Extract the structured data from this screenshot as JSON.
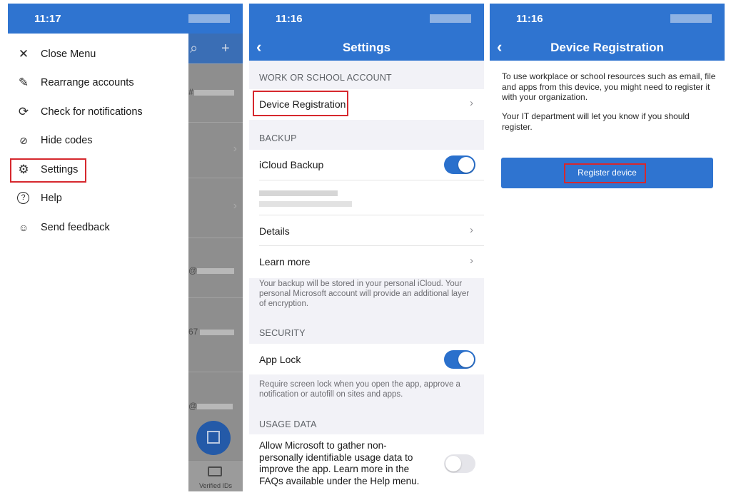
{
  "panel1": {
    "time": "11:17",
    "menu": [
      {
        "icon": "close-icon",
        "label": "Close Menu"
      },
      {
        "icon": "pencil-icon",
        "label": "Rearrange accounts"
      },
      {
        "icon": "refresh-icon",
        "label": "Check for notifications"
      },
      {
        "icon": "eye-slash-icon",
        "label": "Hide codes"
      },
      {
        "icon": "gear-icon",
        "label": "Settings"
      },
      {
        "icon": "help-icon",
        "label": "Help"
      },
      {
        "icon": "feedback-icon",
        "label": "Send feedback"
      }
    ],
    "background_list": {
      "partial_texts": [
        "#",
        "@",
        "67",
        "@"
      ]
    },
    "verified_ids_label": "Verified IDs"
  },
  "panel2": {
    "time": "11:16",
    "title": "Settings",
    "sections": {
      "work": {
        "header": "WORK OR SCHOOL ACCOUNT",
        "device_registration": "Device Registration"
      },
      "backup": {
        "header": "BACKUP",
        "icloud_backup": "iCloud Backup",
        "icloud_backup_on": true,
        "details": "Details",
        "learn_more": "Learn more",
        "footnote": "Your backup will be stored in your personal iCloud. Your personal Microsoft account will provide an additional layer of encryption."
      },
      "security": {
        "header": "SECURITY",
        "app_lock": "App Lock",
        "app_lock_on": true,
        "footnote": "Require screen lock when you open the app, approve a notification or autofill on sites and apps."
      },
      "usage": {
        "header": "USAGE DATA",
        "text": "Allow Microsoft to gather non-personally identifiable usage data to improve the app. Learn more in the FAQs available under the Help menu.",
        "toggle_on": false
      }
    }
  },
  "panel3": {
    "time": "11:16",
    "title": "Device Registration",
    "paragraph1": "To use workplace or school resources such as email, file and apps from this device, you might need to register it with your organization.",
    "paragraph2": "Your IT department will let you know if you should register.",
    "register_button": "Register device"
  },
  "colors": {
    "brand_blue": "#2f74d0",
    "highlight_red": "#d6282e",
    "toggle_on": "#2a70cc"
  }
}
